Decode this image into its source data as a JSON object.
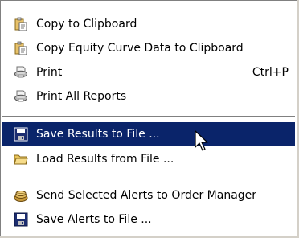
{
  "menu": {
    "items": [
      {
        "label": "Copy to Clipboard",
        "shortcut": "",
        "icon": "clipboard-icon"
      },
      {
        "label": "Copy Equity Curve Data to Clipboard",
        "shortcut": "",
        "icon": "clipboard-icon"
      },
      {
        "label": "Print",
        "shortcut": "Ctrl+P",
        "icon": "printer-icon"
      },
      {
        "label": "Print All Reports",
        "shortcut": "",
        "icon": "printer-icon"
      },
      {
        "label": "Save Results to File ...",
        "shortcut": "",
        "icon": "floppy-disk-icon",
        "highlighted": true
      },
      {
        "label": "Load Results from File ...",
        "shortcut": "",
        "icon": "open-folder-icon"
      },
      {
        "label": "Send Selected Alerts to Order Manager",
        "shortcut": "",
        "icon": "alert-send-icon"
      },
      {
        "label": "Save Alerts to File ...",
        "shortcut": "",
        "icon": "floppy-disk-icon"
      }
    ]
  },
  "colors": {
    "highlight": "#0a246a",
    "menu_bg": "#ffffff",
    "border": "#808080"
  }
}
